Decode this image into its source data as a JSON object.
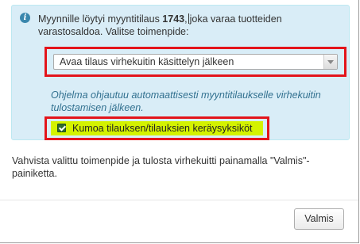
{
  "info": {
    "icon": "info-icon",
    "message_prefix": "Myynnille löytyi myyntitilaus ",
    "order_number": "1743",
    "message_middle": ",",
    "message_suffix": "joka varaa tuotteiden varastosaldoa. Valitse toimenpide:"
  },
  "action_select": {
    "selected": "Avaa tilaus virhekuitin käsittelyn jälkeen"
  },
  "hint": "Ohjelma ohjautuu automaattisesti myyntitilaukselle virhekuitin tulostamisen jälkeen.",
  "cancel_checkbox": {
    "label": "Kumoa tilauksen/tilauksien keräysyksiköt",
    "checked": true
  },
  "confirm_text": "Vahvista valittu toimenpide ja tulosta virhekuitti painamalla \"Valmis\"-painiketta.",
  "footer": {
    "done_label": "Valmis"
  },
  "colors": {
    "info_background": "#d9edf7",
    "highlight_border": "#e3141b",
    "checkbox_highlight": "#d4f200",
    "hint_text": "#31708f"
  }
}
